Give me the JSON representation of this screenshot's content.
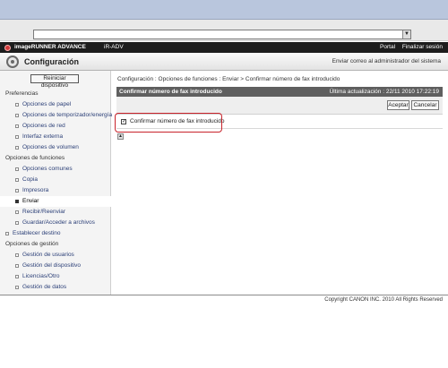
{
  "address_bar": {
    "dropdown_icon": "chevron-down-icon"
  },
  "brand": {
    "name": "imageRUNNER ADVANCE",
    "model": "iR-ADV",
    "portal": "Portal",
    "logout": "Finalizar sesión"
  },
  "app": {
    "title": "Configuración",
    "mail_link": "Enviar correo al administrador del sistema"
  },
  "sidebar": {
    "reboot_label": "Reiniciar dispositivo",
    "nav": [
      {
        "kind": "section",
        "label": "Preferencias"
      },
      {
        "kind": "item",
        "label": "Opciones de papel"
      },
      {
        "kind": "item",
        "label": "Opciones de temporizador/energía"
      },
      {
        "kind": "item",
        "label": "Opciones de red"
      },
      {
        "kind": "item",
        "label": "Interfaz externa"
      },
      {
        "kind": "item",
        "label": "Opciones de volumen"
      },
      {
        "kind": "section",
        "label": "Opciones de funciones"
      },
      {
        "kind": "item",
        "label": "Opciones comunes"
      },
      {
        "kind": "item",
        "label": "Copia"
      },
      {
        "kind": "item",
        "label": "Impresora"
      },
      {
        "kind": "item",
        "label": "Enviar",
        "active": true
      },
      {
        "kind": "item",
        "label": "Recibir/Reenviar"
      },
      {
        "kind": "item",
        "label": "Guardar/Acceder a archivos"
      },
      {
        "kind": "section-link",
        "label": "Establecer destino"
      },
      {
        "kind": "section",
        "label": "Opciones de gestión"
      },
      {
        "kind": "item",
        "label": "Gestión de usuarios"
      },
      {
        "kind": "item",
        "label": "Gestión del dispositivo"
      },
      {
        "kind": "item",
        "label": "Licencias/Otro"
      },
      {
        "kind": "item",
        "label": "Gestión de datos"
      }
    ]
  },
  "content": {
    "breadcrumb": "Configuración : Opciones de funciones : Enviar > Confirmar número de fax introducido",
    "panel_title": "Confirmar número de fax introducido",
    "updated": "Última actualización : 22/11 2010 17:22:19",
    "ok_label": "Aceptar",
    "cancel_label": "Cancelar",
    "checkbox_label": "Confirmar número de fax introducido",
    "checkbox_checked": true,
    "checkbox_mark": "✓",
    "top_mark": "▲"
  },
  "footer": {
    "copyright": "Copyright CANON INC. 2010 All Rights Reserved"
  },
  "colors": {
    "brand_bar": "#1d1d1d",
    "panel_header": "#5f5f5f",
    "highlight": "#c8232b"
  }
}
